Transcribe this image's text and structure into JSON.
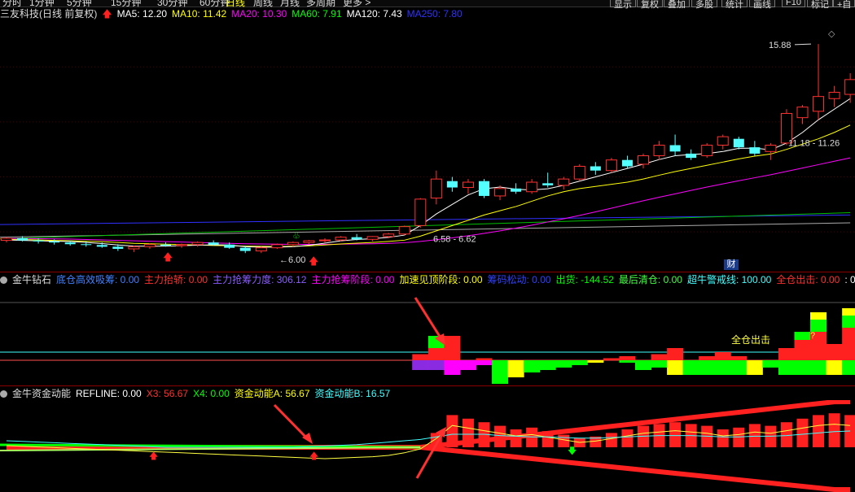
{
  "toolbar": {
    "tabs": [
      "分时",
      "1分钟",
      "5分钟",
      "15分钟",
      "30分钟",
      "60分钟",
      "日线",
      "周线",
      "月线",
      "多周期",
      "更多 >"
    ],
    "active_tab": "日线",
    "buttons": [
      "显示",
      "复权",
      "叠加",
      "多股",
      "统计",
      "画线",
      "F10",
      "标记",
      "+自"
    ]
  },
  "main_header": {
    "stock": "三友科技(日线 前复权)",
    "ma": [
      {
        "label": "MA5: 12.20",
        "color": "#ffffff"
      },
      {
        "label": "MA10: 11.42",
        "color": "#ffff00"
      },
      {
        "label": "MA20: 10.30",
        "color": "#ff00ff"
      },
      {
        "label": "MA60: 7.91",
        "color": "#00ff00"
      },
      {
        "label": "MA120: 7.43",
        "color": "#ffffff"
      },
      {
        "label": "MA250: 7.80",
        "color": "#3030ff"
      }
    ]
  },
  "main_annotations": {
    "high": "15.88",
    "range_mid": "11.18 - 11.26",
    "range_low": "6.58 - 6.62",
    "low_mark": "6.00",
    "cai_badge": "财"
  },
  "panel1_header": {
    "title": "金牛钻石",
    "items": [
      {
        "label": "底仓高效吸筹: 0.00",
        "color": "#4080ff"
      },
      {
        "label": "主力抬轿: 0.00",
        "color": "#ff3030"
      },
      {
        "label": "主力抢筹力度: 306.12",
        "color": "#8a5cff"
      },
      {
        "label": "主力抢筹阶段: 0.00",
        "color": "#ff00ff"
      },
      {
        "label": "加速见顶阶段: 0.00",
        "color": "#ffff00"
      },
      {
        "label": "筹码松动: 0.00",
        "color": "#3040ff"
      },
      {
        "label": "出货: -144.52",
        "color": "#00ff00"
      },
      {
        "label": "最后清仓: 0.00",
        "color": "#40ff40"
      },
      {
        "label": "超牛警戒线: 100.00",
        "color": "#40ffff"
      },
      {
        "label": "全仓出击: 0.00",
        "color": "#ff3030"
      },
      {
        "label": ": 0",
        "color": "#ffffff"
      }
    ],
    "annotation": "全仓出击",
    "q": "?"
  },
  "panel2_header": {
    "title": "金牛资金动能",
    "items": [
      {
        "label": "REFLINE: 0.00",
        "color": "#ffffff"
      },
      {
        "label": "X3: 56.67",
        "color": "#ff3030"
      },
      {
        "label": "X4: 0.00",
        "color": "#00ff00"
      },
      {
        "label": "资金动能A: 56.67",
        "color": "#ffff00"
      },
      {
        "label": "资金动能B: 16.57",
        "color": "#40ffff"
      }
    ]
  },
  "chart_data": {
    "type": "candlestick",
    "candles": [
      [
        6.6,
        6.75,
        6.5,
        6.7
      ],
      [
        6.7,
        6.8,
        6.55,
        6.6
      ],
      [
        6.6,
        6.7,
        6.45,
        6.55
      ],
      [
        6.55,
        6.65,
        6.4,
        6.5
      ],
      [
        6.5,
        6.6,
        6.35,
        6.42
      ],
      [
        6.42,
        6.55,
        6.3,
        6.38
      ],
      [
        6.38,
        6.5,
        6.25,
        6.3
      ],
      [
        6.3,
        6.42,
        6.1,
        6.2
      ],
      [
        6.2,
        6.35,
        6.05,
        6.3
      ],
      [
        6.3,
        6.45,
        6.2,
        6.4
      ],
      [
        6.4,
        6.5,
        6.3,
        6.35
      ],
      [
        6.35,
        6.45,
        6.25,
        6.4
      ],
      [
        6.4,
        6.55,
        6.3,
        6.5
      ],
      [
        6.5,
        6.6,
        6.35,
        6.4
      ],
      [
        6.4,
        6.5,
        6.2,
        6.25
      ],
      [
        6.25,
        6.35,
        6.0,
        6.1
      ],
      [
        6.1,
        6.3,
        6.0,
        6.25
      ],
      [
        6.25,
        6.45,
        6.2,
        6.4
      ],
      [
        6.4,
        6.55,
        6.3,
        6.5
      ],
      [
        6.5,
        6.62,
        6.4,
        6.58
      ],
      [
        6.58,
        6.7,
        6.5,
        6.62
      ],
      [
        6.62,
        6.8,
        6.55,
        6.75
      ],
      [
        6.75,
        6.9,
        6.6,
        6.65
      ],
      [
        6.65,
        6.8,
        6.55,
        6.78
      ],
      [
        6.78,
        6.95,
        6.7,
        6.9
      ],
      [
        6.9,
        7.3,
        6.85,
        7.25
      ],
      [
        7.3,
        8.6,
        7.2,
        8.55
      ],
      [
        8.6,
        9.9,
        8.3,
        9.5
      ],
      [
        9.4,
        9.6,
        8.9,
        9.1
      ],
      [
        9.1,
        9.5,
        8.8,
        9.35
      ],
      [
        9.4,
        9.5,
        8.6,
        8.7
      ],
      [
        8.7,
        9.2,
        8.5,
        9.05
      ],
      [
        9.05,
        9.3,
        8.8,
        8.9
      ],
      [
        8.9,
        9.5,
        8.8,
        9.35
      ],
      [
        9.3,
        9.8,
        9.1,
        9.2
      ],
      [
        9.2,
        9.6,
        9.0,
        9.5
      ],
      [
        9.5,
        10.2,
        9.4,
        10.1
      ],
      [
        10.1,
        10.3,
        9.7,
        9.9
      ],
      [
        9.9,
        10.5,
        9.8,
        10.4
      ],
      [
        10.4,
        10.6,
        10.0,
        10.1
      ],
      [
        10.2,
        10.7,
        10.0,
        10.6
      ],
      [
        10.6,
        11.3,
        10.4,
        11.1
      ],
      [
        11.1,
        11.6,
        10.6,
        10.8
      ],
      [
        10.7,
        10.9,
        10.4,
        10.5
      ],
      [
        10.6,
        11.2,
        10.5,
        11.1
      ],
      [
        11.1,
        11.6,
        10.9,
        11.5
      ],
      [
        11.4,
        11.5,
        10.9,
        11.0
      ],
      [
        11.0,
        11.3,
        10.6,
        10.7
      ],
      [
        10.8,
        11.2,
        10.4,
        11.1
      ],
      [
        11.2,
        12.8,
        11.1,
        12.6
      ],
      [
        12.4,
        13.0,
        12.1,
        12.9
      ],
      [
        12.7,
        15.88,
        12.3,
        13.4
      ],
      [
        13.3,
        13.9,
        12.9,
        13.6
      ],
      [
        13.5,
        14.5,
        13.1,
        14.2
      ]
    ],
    "ma5": [
      6.62,
      6.6,
      6.58,
      6.56,
      6.55,
      6.5,
      6.45,
      6.38,
      6.33,
      6.32,
      6.33,
      6.35,
      6.37,
      6.39,
      6.38,
      6.3,
      6.28,
      6.28,
      6.3,
      6.37,
      6.47,
      6.58,
      6.64,
      6.68,
      6.74,
      6.85,
      7.3,
      7.85,
      8.3,
      8.75,
      9.04,
      9.12,
      9.02,
      8.98,
      9.04,
      9.2,
      9.4,
      9.6,
      9.8,
      10.0,
      10.2,
      10.42,
      10.6,
      10.66,
      10.7,
      10.8,
      10.95,
      10.96,
      10.88,
      11.2,
      11.7,
      12.3,
      12.8,
      13.3
    ],
    "ma10": [
      6.65,
      6.64,
      6.62,
      6.6,
      6.58,
      6.56,
      6.54,
      6.5,
      6.46,
      6.44,
      6.42,
      6.4,
      6.38,
      6.36,
      6.35,
      6.33,
      6.32,
      6.31,
      6.32,
      6.34,
      6.38,
      6.43,
      6.47,
      6.5,
      6.55,
      6.61,
      6.8,
      7.05,
      7.3,
      7.55,
      7.8,
      8.0,
      8.2,
      8.45,
      8.7,
      8.9,
      9.05,
      9.15,
      9.25,
      9.35,
      9.5,
      9.68,
      9.85,
      10.0,
      10.15,
      10.3,
      10.45,
      10.58,
      10.68,
      10.9,
      11.15,
      11.4,
      11.7,
      12.05
    ],
    "ma20": [
      6.7,
      6.69,
      6.68,
      6.67,
      6.66,
      6.64,
      6.62,
      6.6,
      6.58,
      6.56,
      6.54,
      6.52,
      6.5,
      6.48,
      6.46,
      6.44,
      6.43,
      6.42,
      6.41,
      6.41,
      6.41,
      6.42,
      6.43,
      6.44,
      6.46,
      6.49,
      6.55,
      6.63,
      6.72,
      6.82,
      6.93,
      7.05,
      7.18,
      7.32,
      7.47,
      7.62,
      7.78,
      7.95,
      8.12,
      8.3,
      8.47,
      8.64,
      8.8,
      8.96,
      9.12,
      9.27,
      9.42,
      9.56,
      9.7,
      9.86,
      10.02,
      10.18,
      10.34,
      10.5
    ],
    "ma60": {
      "from": [
        0,
        6.68
      ],
      "to": [
        53,
        7.91
      ]
    },
    "ma120": {
      "from": [
        0,
        6.75
      ],
      "to": [
        53,
        7.43
      ]
    },
    "ma250": {
      "from": [
        0,
        7.35
      ],
      "to": [
        53,
        7.8
      ]
    },
    "panel1_bars": [
      [
        0,
        0,
        0,
        0
      ],
      [
        0,
        0,
        0,
        0
      ],
      [
        0,
        0,
        0,
        0
      ],
      [
        0,
        0,
        0,
        0
      ],
      [
        0,
        0,
        0,
        0
      ],
      [
        0,
        0,
        0,
        0
      ],
      [
        0,
        0,
        0,
        0
      ],
      [
        0,
        0,
        0,
        0
      ],
      [
        0,
        0,
        0,
        0
      ],
      [
        0,
        0,
        0,
        0
      ],
      [
        0,
        0,
        0,
        0
      ],
      [
        0,
        0,
        0,
        0
      ],
      [
        0,
        0,
        0,
        0
      ],
      [
        0,
        0,
        0,
        0
      ],
      [
        0,
        0,
        0,
        0
      ],
      [
        0,
        0,
        0,
        0
      ],
      [
        0,
        0,
        0,
        0
      ],
      [
        0,
        0,
        0,
        0
      ],
      [
        0,
        0,
        0,
        0
      ],
      [
        0,
        0,
        0,
        0
      ],
      [
        0,
        0,
        0,
        0
      ],
      [
        0,
        0,
        0,
        0
      ],
      [
        0,
        0,
        0,
        0
      ],
      [
        0,
        0,
        0,
        0
      ],
      [
        0,
        0,
        0,
        0
      ],
      [
        0,
        0,
        0,
        0
      ],
      [
        0.15,
        0,
        0,
        0.4
      ],
      [
        0.3,
        0.3,
        0,
        0.4
      ],
      [
        0.6,
        0,
        0,
        0.6
      ],
      [
        0,
        0,
        0,
        0.4
      ],
      [
        0.05,
        0,
        0,
        0.2
      ],
      [
        0,
        0,
        0,
        1.0
      ],
      [
        0,
        0,
        0,
        0.7
      ],
      [
        0,
        0,
        0,
        0.5
      ],
      [
        0,
        0,
        0,
        0.4
      ],
      [
        0,
        0,
        0,
        0.3
      ],
      [
        0,
        0,
        0,
        0.2
      ],
      [
        0,
        0,
        0,
        0.1
      ],
      [
        0.05,
        0,
        0,
        0
      ],
      [
        0.1,
        0,
        0,
        0.1
      ],
      [
        0,
        0,
        0,
        0.4
      ],
      [
        0.15,
        0,
        0,
        0.3
      ],
      [
        0.3,
        0,
        0,
        0.6
      ],
      [
        0,
        0,
        0,
        0.6
      ],
      [
        0.1,
        0,
        0,
        0.6
      ],
      [
        0.2,
        0,
        0,
        0.6
      ],
      [
        0.1,
        0,
        0,
        0.6
      ],
      [
        0,
        0,
        0,
        0.6
      ],
      [
        0,
        0,
        0,
        0.3
      ],
      [
        0.3,
        0,
        0,
        0.6
      ],
      [
        0.5,
        0.2,
        0,
        0.6
      ],
      [
        0.7,
        0.3,
        0.3,
        0.6
      ],
      [
        0.4,
        0,
        0,
        0.6
      ],
      [
        0.8,
        0.3,
        0.3,
        0.6
      ]
    ],
    "panel2_A": [
      25,
      24,
      23,
      22,
      21,
      20,
      19,
      18,
      17,
      16,
      15,
      14,
      13,
      12,
      11,
      10,
      9,
      8,
      7,
      6,
      5,
      6,
      7,
      8,
      10,
      14,
      20,
      36,
      56,
      52,
      48,
      44,
      40,
      42,
      38,
      34,
      30,
      32,
      36,
      40,
      44,
      46,
      48,
      46,
      44,
      40,
      42,
      46,
      44,
      48,
      52,
      56,
      58,
      56
    ],
    "panel2_B": [
      20,
      19,
      18,
      17,
      16,
      15,
      14,
      13,
      12,
      11,
      10,
      10,
      10,
      10,
      10,
      10,
      10,
      10,
      10,
      11,
      12,
      13,
      14,
      16,
      18,
      20,
      22,
      26,
      30,
      30,
      30,
      28,
      27,
      26,
      26,
      25,
      24,
      24,
      25,
      26,
      27,
      28,
      28,
      28,
      27,
      26,
      26,
      27,
      27,
      28,
      30,
      32,
      34,
      35
    ]
  }
}
